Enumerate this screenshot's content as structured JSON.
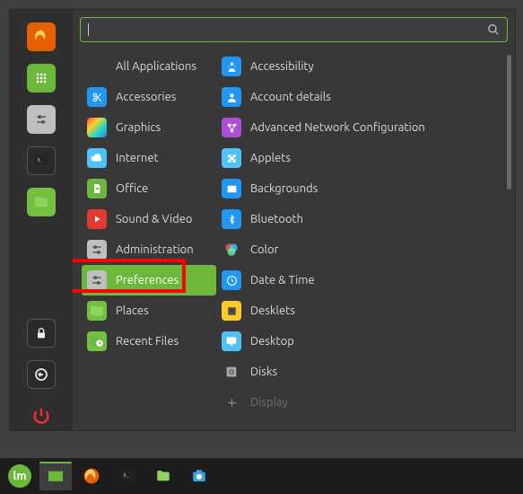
{
  "search": {
    "placeholder": ""
  },
  "favorites": [
    {
      "name": "firefox",
      "tile": "bg-orange",
      "glyph": "firefox"
    },
    {
      "name": "apps-grid",
      "tile": "bg-green",
      "glyph": "grid"
    },
    {
      "name": "settings",
      "tile": "bg-grey",
      "glyph": "sliders"
    },
    {
      "name": "terminal",
      "tile": "bg-dark",
      "glyph": "term"
    },
    {
      "name": "files",
      "tile": "bg-folder",
      "glyph": "folder"
    }
  ],
  "favorites_bottom": [
    {
      "name": "lock",
      "tile": "bg-dark",
      "glyph": "lock"
    },
    {
      "name": "logout",
      "tile": "bg-dark",
      "glyph": "logout"
    },
    {
      "name": "quit",
      "tile": "",
      "glyph": "power"
    }
  ],
  "categories": [
    {
      "label": "All Applications",
      "icon": null
    },
    {
      "label": "Accessories",
      "icon": "scissors",
      "tile": "bg-blue"
    },
    {
      "label": "Graphics",
      "icon": "square",
      "tile": "bg-rainbow"
    },
    {
      "label": "Internet",
      "icon": "cloud",
      "tile": "bg-sky"
    },
    {
      "label": "Office",
      "icon": "doc",
      "tile": "bg-green"
    },
    {
      "label": "Sound & Video",
      "icon": "play",
      "tile": "bg-red"
    },
    {
      "label": "Administration",
      "icon": "sliders",
      "tile": "bg-grey"
    },
    {
      "label": "Preferences",
      "icon": "sliders",
      "tile": "bg-grey",
      "selected": true
    },
    {
      "label": "Places",
      "icon": "folder",
      "tile": "bg-folder"
    },
    {
      "label": "Recent Files",
      "icon": "clockfolder",
      "tile": "bg-folder"
    }
  ],
  "apps": [
    {
      "label": "Accessibility",
      "tile": "bg-blue",
      "glyph": "person"
    },
    {
      "label": "Account details",
      "tile": "bg-blue",
      "glyph": "user"
    },
    {
      "label": "Advanced Network Configuration",
      "tile": "bg-purple",
      "glyph": "net"
    },
    {
      "label": "Applets",
      "tile": "bg-sky",
      "glyph": "puzzle"
    },
    {
      "label": "Backgrounds",
      "tile": "bg-blue",
      "glyph": "bg"
    },
    {
      "label": "Bluetooth",
      "tile": "bg-blue",
      "glyph": "bt"
    },
    {
      "label": "Color",
      "tile": "",
      "glyph": "color"
    },
    {
      "label": "Date & Time",
      "tile": "bg-blue",
      "glyph": "clock"
    },
    {
      "label": "Desklets",
      "tile": "bg-yellow",
      "glyph": "note"
    },
    {
      "label": "Desktop",
      "tile": "bg-sky",
      "glyph": "screen"
    },
    {
      "label": "Disks",
      "tile": "",
      "glyph": "disk"
    },
    {
      "label": "Display",
      "tile": "",
      "glyph": "display",
      "dim": true
    }
  ],
  "taskbar": [
    {
      "name": "menu",
      "glyph": "mint"
    },
    {
      "name": "show-desktop",
      "glyph": "desk",
      "active": true
    },
    {
      "name": "firefox",
      "glyph": "firefox"
    },
    {
      "name": "terminal",
      "glyph": "term"
    },
    {
      "name": "files",
      "glyph": "folder"
    },
    {
      "name": "screenshot",
      "glyph": "camera"
    }
  ],
  "highlight": {
    "index": 7
  }
}
